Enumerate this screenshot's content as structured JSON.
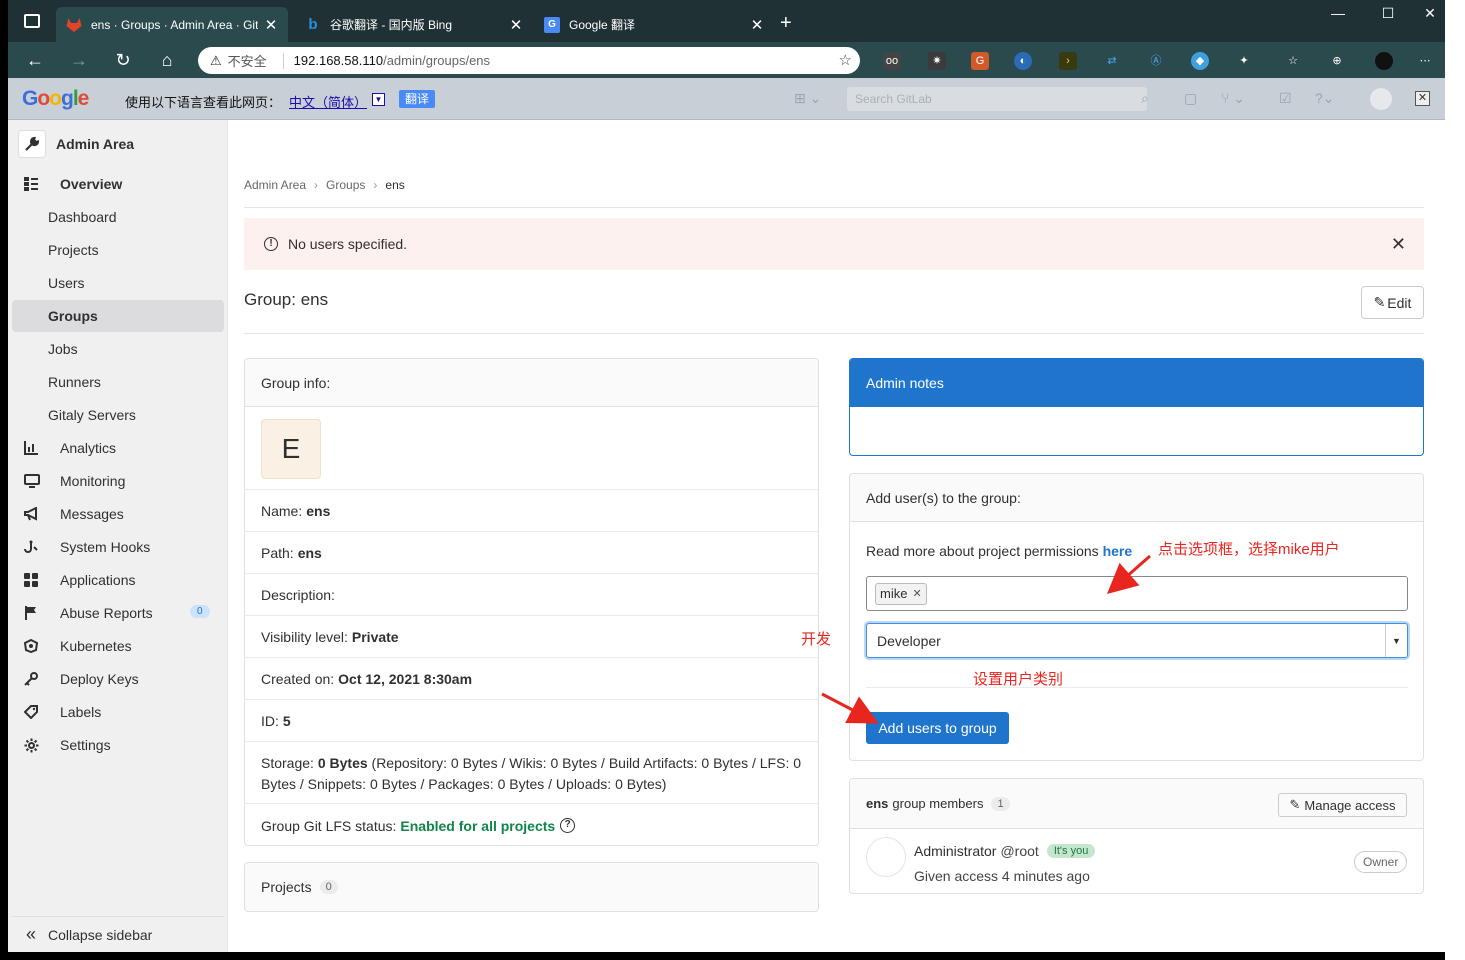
{
  "browser": {
    "tabs": [
      {
        "title": "ens · Groups · Admin Area · GitLa",
        "icon": "gitlab-fox-icon",
        "color": "#e24329"
      },
      {
        "title": "谷歌翻译 - 国内版 Bing",
        "icon": "bing-icon",
        "color": "#2b8fe0"
      },
      {
        "title": "Google 翻译",
        "icon": "google-translate-icon",
        "color": "#4a8af4"
      }
    ],
    "insecure": "不安全",
    "url_host": "192.168.58.110",
    "url_path": "/admin/groups/ens"
  },
  "translate_bar": {
    "message": "使用以下语言查看此网页：",
    "language": "中文（简体）",
    "button": "翻译",
    "search_placeholder": "Search GitLab"
  },
  "sidebar": {
    "title": "Admin Area",
    "overview": "Overview",
    "items": [
      {
        "label": "Dashboard",
        "sub": true
      },
      {
        "label": "Projects",
        "sub": true
      },
      {
        "label": "Users",
        "sub": true
      },
      {
        "label": "Groups",
        "sub": true,
        "active": true
      },
      {
        "label": "Jobs",
        "sub": true
      },
      {
        "label": "Runners",
        "sub": true
      },
      {
        "label": "Gitaly Servers",
        "sub": true
      },
      {
        "label": "Analytics",
        "icon": "chart-icon"
      },
      {
        "label": "Monitoring",
        "icon": "monitor-icon"
      },
      {
        "label": "Messages",
        "icon": "bullhorn-icon"
      },
      {
        "label": "System Hooks",
        "icon": "hook-icon"
      },
      {
        "label": "Applications",
        "icon": "grid-icon"
      },
      {
        "label": "Abuse Reports",
        "icon": "flag-icon",
        "badge": "0"
      },
      {
        "label": "Kubernetes",
        "icon": "kubernetes-icon"
      },
      {
        "label": "Deploy Keys",
        "icon": "key-icon"
      },
      {
        "label": "Labels",
        "icon": "label-icon"
      },
      {
        "label": "Settings",
        "icon": "gear-icon"
      }
    ],
    "collapse": "Collapse sidebar"
  },
  "breadcrumb": [
    "Admin Area",
    "Groups",
    "ens"
  ],
  "alert": "No users specified.",
  "page_title": "Group: ens",
  "edit": "Edit",
  "group_info": {
    "header": "Group info:",
    "avatar_letter": "E",
    "name_label": "Name:",
    "name": "ens",
    "path_label": "Path:",
    "path": "ens",
    "description_label": "Description:",
    "visibility_label": "Visibility level:",
    "visibility": "Private",
    "created_label": "Created on:",
    "created": "Oct 12, 2021 8:30am",
    "id_label": "ID:",
    "id": "5",
    "storage_label": "Storage:",
    "storage_total": "0 Bytes",
    "storage_detail_1": "(Repository: 0 Bytes / Wikis: 0 Bytes / Build Artifacts: 0 Bytes / LFS: 0",
    "storage_detail_2": "Bytes / Snippets: 0 Bytes / Packages: 0 Bytes / Uploads: 0 Bytes)",
    "lfs_label": "Group Git LFS status:",
    "lfs": "Enabled for all projects"
  },
  "projects": {
    "label": "Projects",
    "count": "0"
  },
  "admin_notes": {
    "header": "Admin notes"
  },
  "add_users": {
    "header": "Add user(s) to the group:",
    "permissions_text": "Read more about project permissions",
    "permissions_link": "here",
    "selected_user": "mike",
    "role": "Developer",
    "button": "Add users to group"
  },
  "members": {
    "group": "ens",
    "label": "group members",
    "count": "1",
    "manage": "Manage access",
    "name": "Administrator",
    "username": "@root",
    "you_badge": "It's you",
    "given": "Given access 4 minutes ago",
    "role": "Owner"
  },
  "annotations": {
    "select_user": "点击选项框，选择mike用户",
    "develop": "开发",
    "set_role": "设置用户类别"
  },
  "colors": {
    "accent": "#1f75cb",
    "alert_bg": "#fcf1ef",
    "annotation": "#e8261f",
    "success": "#108548"
  }
}
